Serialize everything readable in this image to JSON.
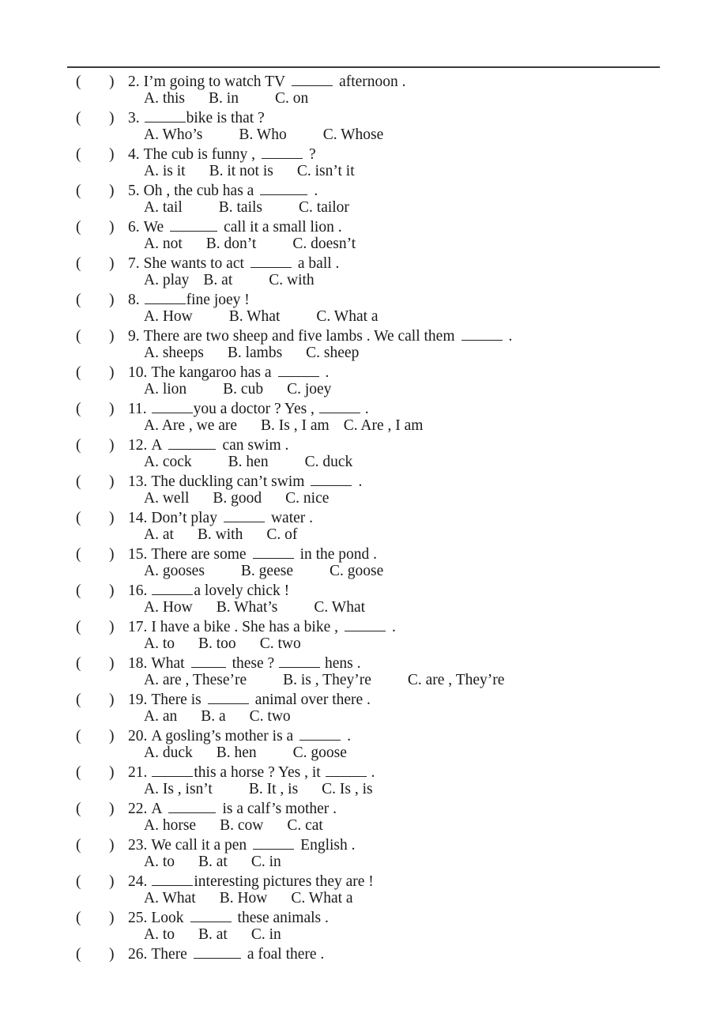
{
  "document": {
    "type": "english-grammar-multiple-choice-worksheet",
    "page_rule": true,
    "blank_marker": "_____"
  },
  "questions": [
    {
      "number": "2.",
      "stem_before": "I’m going to watch TV",
      "blank": "w2",
      "stem_after": "afternoon .",
      "options": [
        "A. this",
        "B. in",
        "C. on"
      ],
      "gaps": [
        "md",
        "lg"
      ]
    },
    {
      "number": "3.",
      "stem_before": "",
      "blank": "w2",
      "stem_after": "bike is that ?",
      "options": [
        "A. Who’s",
        "B. Who",
        "C. Whose"
      ],
      "gaps": [
        "lg",
        "lg"
      ]
    },
    {
      "number": "4.",
      "stem_before": "The cub is funny ,",
      "blank": "w2",
      "stem_after": "?",
      "options": [
        "A. is it",
        "B. it not is",
        "C. isn’t it"
      ],
      "gaps": [
        "md",
        "md"
      ]
    },
    {
      "number": "5.",
      "stem_before": "Oh , the cub has a",
      "blank": "w3",
      "stem_after": ".",
      "options": [
        "A. tail",
        "B. tails",
        "C. tailor"
      ],
      "gaps": [
        "lg",
        "lg"
      ]
    },
    {
      "number": "6.",
      "stem_before": "We",
      "blank": "w3",
      "stem_after": "call it a small lion .",
      "options": [
        "A. not",
        "B. don’t",
        "C. doesn’t"
      ],
      "gaps": [
        "md",
        "lg"
      ]
    },
    {
      "number": "7.",
      "stem_before": "She wants to act",
      "blank": "w2",
      "stem_after": "a ball .",
      "options": [
        "A. play",
        "B. at",
        "C. with"
      ],
      "gaps": [
        "sm",
        "lg"
      ]
    },
    {
      "number": "8.",
      "stem_before": "",
      "blank": "w2",
      "stem_after": "fine joey !",
      "options": [
        "A. How",
        "B. What",
        "C. What a"
      ],
      "gaps": [
        "lg",
        "lg"
      ]
    },
    {
      "number": "9.",
      "stem_before": "There are two sheep and five lambs . We call them",
      "blank": "w2",
      "stem_after": ".",
      "options": [
        "A. sheeps",
        "B. lambs",
        "C. sheep"
      ],
      "gaps": [
        "md",
        "md"
      ]
    },
    {
      "number": "10.",
      "stem_before": "The kangaroo has a",
      "blank": "w2",
      "stem_after": ".",
      "options": [
        "A. lion",
        "B. cub",
        "C. joey"
      ],
      "gaps": [
        "lg",
        "md"
      ]
    },
    {
      "number": "11.",
      "stem_before": "",
      "blank": "w2",
      "stem_after": "you a doctor ? Yes ,  _____  .",
      "options": [
        "A. Are , we are",
        "B. Is , I am",
        "C. Are , I am"
      ],
      "gaps": [
        "md",
        "sm"
      ]
    },
    {
      "number": "12.",
      "stem_before": "A",
      "blank": "w3",
      "stem_after": "can swim .",
      "options": [
        "A. cock",
        "B. hen",
        "C. duck"
      ],
      "gaps": [
        "lg",
        "lg"
      ]
    },
    {
      "number": "13.",
      "stem_before": "The duckling can’t swim",
      "blank": "w2",
      "stem_after": ".",
      "options": [
        "A. well",
        "B. good",
        "C. nice"
      ],
      "gaps": [
        "md",
        "md"
      ]
    },
    {
      "number": "14.",
      "stem_before": "Don’t play",
      "blank": "w2",
      "stem_after": "water .",
      "options": [
        "A. at",
        "B. with",
        "C. of"
      ],
      "gaps": [
        "md",
        "md"
      ]
    },
    {
      "number": "15.",
      "stem_before": "There are some",
      "blank": "w2",
      "stem_after": "in the pond .",
      "options": [
        "A. gooses",
        "B. geese",
        "C. goose"
      ],
      "gaps": [
        "lg",
        "lg"
      ]
    },
    {
      "number": "16.",
      "stem_before": "",
      "blank": "w2",
      "stem_after": "a lovely chick !",
      "options": [
        "A. How",
        "B. What’s",
        "C. What"
      ],
      "gaps": [
        "md",
        "lg"
      ]
    },
    {
      "number": "17.",
      "stem_before": "I have a bike . She has a bike ,",
      "blank": "w2",
      "stem_after": ".",
      "options": [
        "A. to",
        "B. too",
        "C. two"
      ],
      "gaps": [
        "md",
        "md"
      ]
    },
    {
      "number": "18.",
      "stem_before": "What",
      "blank": "w1",
      "stem_after": "these ?  _____  hens .",
      "options": [
        "A. are , These’re",
        "B. is , They’re",
        "C. are , They’re"
      ],
      "gaps": [
        "lg",
        "lg"
      ]
    },
    {
      "number": "19.",
      "stem_before": "There is",
      "blank": "w2",
      "stem_after": "animal over there .",
      "options": [
        "A. an",
        "B. a",
        "C. two"
      ],
      "gaps": [
        "md",
        "md"
      ]
    },
    {
      "number": "20.",
      "stem_before": "A gosling’s mother is a",
      "blank": "w2",
      "stem_after": ".",
      "options": [
        "A. duck",
        "B. hen",
        "C. goose"
      ],
      "gaps": [
        "md",
        "lg"
      ]
    },
    {
      "number": "21.",
      "stem_before": "",
      "blank": "w2",
      "stem_after": "this a horse ? Yes , it  _____  .",
      "options": [
        "A. Is , isn’t",
        "B. It , is",
        "C. Is , is"
      ],
      "gaps": [
        "lg",
        "md"
      ]
    },
    {
      "number": "22.",
      "stem_before": "A",
      "blank": "w3",
      "stem_after": "is a calf’s mother .",
      "options": [
        "A. horse",
        "B. cow",
        "C. cat"
      ],
      "gaps": [
        "md",
        "md"
      ]
    },
    {
      "number": "23.",
      "stem_before": "We call it a pen",
      "blank": "w2",
      "stem_after": "English .",
      "options": [
        "A. to",
        "B. at",
        "C. in"
      ],
      "gaps": [
        "md",
        "md"
      ]
    },
    {
      "number": "24.",
      "stem_before": "",
      "blank": "w2",
      "stem_after": "interesting pictures they are !",
      "options": [
        "A. What",
        "B. How",
        "C. What a"
      ],
      "gaps": [
        "md",
        "md"
      ]
    },
    {
      "number": "25.",
      "stem_before": "Look",
      "blank": "w2",
      "stem_after": "these animals .",
      "options": [
        "A. to",
        "B. at",
        "C. in"
      ],
      "gaps": [
        "md",
        "md"
      ]
    },
    {
      "number": "26.",
      "stem_before": "There",
      "blank": "w3",
      "stem_after": "a foal there .",
      "options": [],
      "gaps": []
    }
  ]
}
